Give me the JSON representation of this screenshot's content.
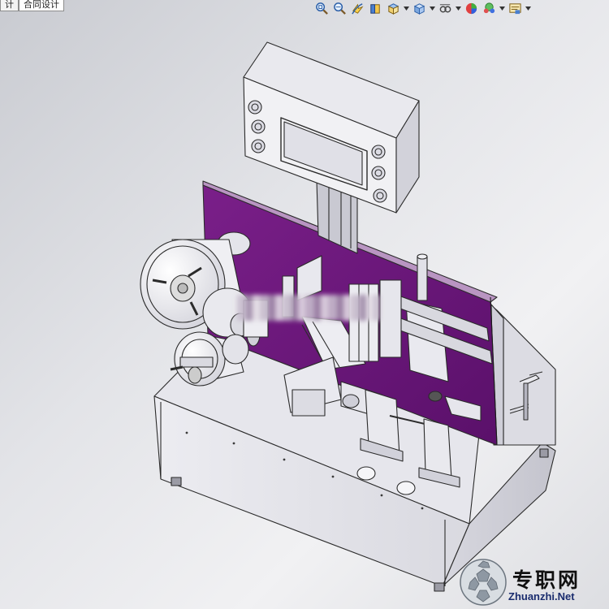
{
  "tabs": [
    {
      "label": "计"
    },
    {
      "label": "合同设计"
    }
  ],
  "toolbar": {
    "buttons": [
      {
        "icon": "zoom-to-fit-icon",
        "has_dropdown": false
      },
      {
        "icon": "zoom-to-area-icon",
        "has_dropdown": false
      },
      {
        "icon": "previous-view-icon",
        "has_dropdown": false
      },
      {
        "icon": "section-view-icon",
        "has_dropdown": false
      },
      {
        "icon": "view-orientation-icon",
        "has_dropdown": true
      },
      {
        "icon": "display-style-icon",
        "has_dropdown": true
      },
      {
        "icon": "hide-show-items-icon",
        "has_dropdown": true
      },
      {
        "icon": "edit-appearance-icon",
        "has_dropdown": false
      },
      {
        "icon": "apply-scene-icon",
        "has_dropdown": true
      },
      {
        "icon": "view-settings-icon",
        "has_dropdown": true
      }
    ]
  },
  "model": {
    "subject": "automatic labeling machine 3D assembly",
    "colors": {
      "panel": "#6a1678",
      "body": "#e4e4ea",
      "edge": "#2b2b2b"
    }
  },
  "watermark": {
    "logo_text": "专职网",
    "url_text": "Zhuanzhi.Net"
  }
}
